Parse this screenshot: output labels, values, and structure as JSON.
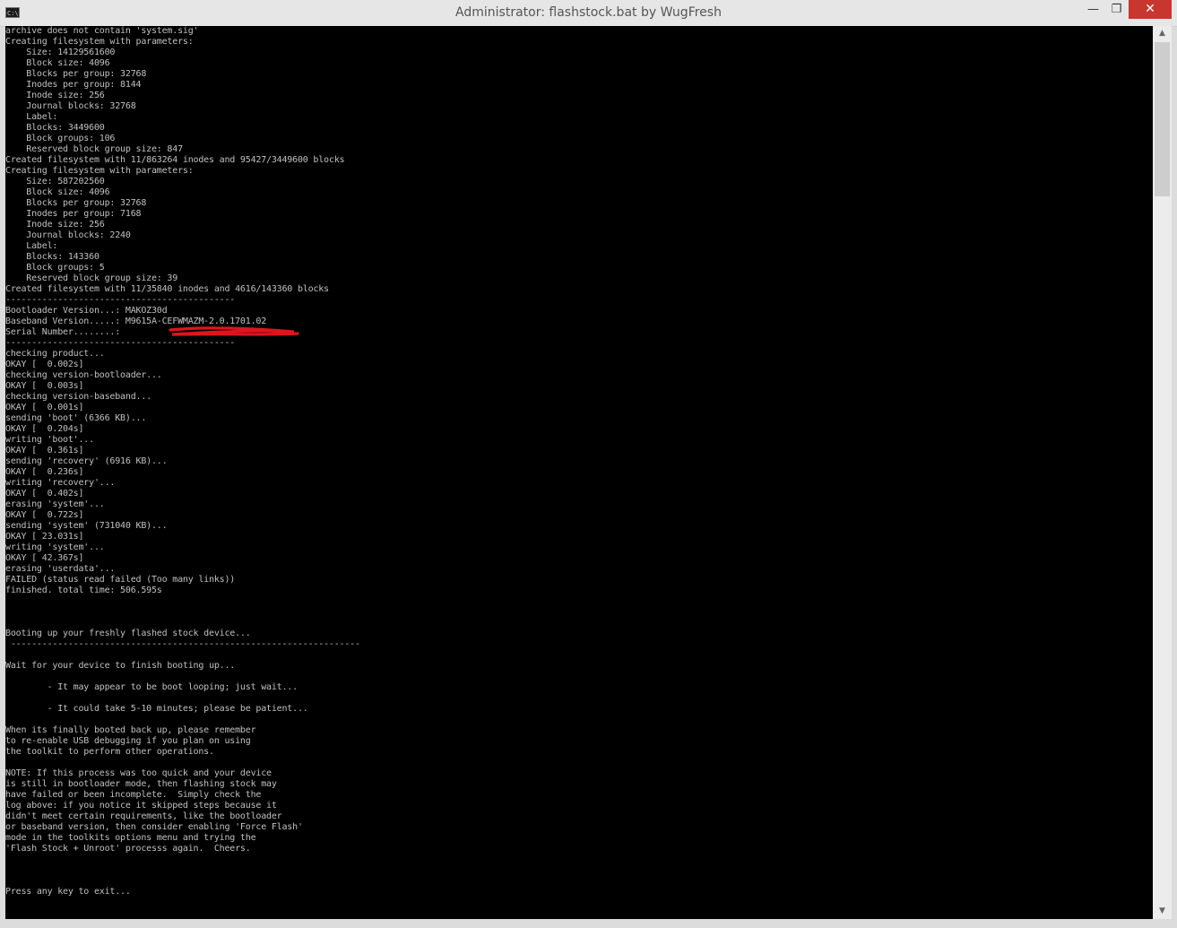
{
  "window": {
    "title": "Administrator:  flashstock.bat by WugFresh",
    "icon_text": "C:\\.",
    "min_glyph": "—",
    "max_glyph": "❐",
    "close_glyph": "✕"
  },
  "scrollbar": {
    "up_glyph": "▲",
    "down_glyph": "▼"
  },
  "colors": {
    "console_bg": "#000000",
    "console_text": "#c0c0c0",
    "close_button": "#c7372f",
    "redaction": "#e0141e"
  },
  "console": {
    "text": "archive does not contain 'system.sig'\nCreating filesystem with parameters:\n    Size: 14129561600\n    Block size: 4096\n    Blocks per group: 32768\n    Inodes per group: 8144\n    Inode size: 256\n    Journal blocks: 32768\n    Label:\n    Blocks: 3449600\n    Block groups: 106\n    Reserved block group size: 847\nCreated filesystem with 11/863264 inodes and 95427/3449600 blocks\nCreating filesystem with parameters:\n    Size: 587202560\n    Block size: 4096\n    Blocks per group: 32768\n    Inodes per group: 7168\n    Inode size: 256\n    Journal blocks: 2240\n    Label:\n    Blocks: 143360\n    Block groups: 5\n    Reserved block group size: 39\nCreated filesystem with 11/35840 inodes and 4616/143360 blocks\n--------------------------------------------\nBootloader Version...: MAKOZ30d\nBaseband Version.....: M9615A-CEFWMAZM-2.0.1701.02\nSerial Number........: \n--------------------------------------------\nchecking product...\nOKAY [  0.002s]\nchecking version-bootloader...\nOKAY [  0.003s]\nchecking version-baseband...\nOKAY [  0.001s]\nsending 'boot' (6366 KB)...\nOKAY [  0.204s]\nwriting 'boot'...\nOKAY [  0.361s]\nsending 'recovery' (6916 KB)...\nOKAY [  0.236s]\nwriting 'recovery'...\nOKAY [  0.402s]\nerasing 'system'...\nOKAY [  0.722s]\nsending 'system' (731040 KB)...\nOKAY [ 23.031s]\nwriting 'system'...\nOKAY [ 42.367s]\nerasing 'userdata'...\nFAILED (status read failed (Too many links))\nfinished. total time: 506.595s\n\n\n\nBooting up your freshly flashed stock device...\n -------------------------------------------------------------------\n\nWait for your device to finish booting up...\n\n        - It may appear to be boot looping; just wait...\n\n        - It could take 5-10 minutes; please be patient...\n\nWhen its finally booted back up, please remember\nto re-enable USB debugging if you plan on using\nthe toolkit to perform other operations.\n\nNOTE: If this process was too quick and your device\nis still in bootloader mode, then flashing stock may\nhave failed or been incomplete.  Simply check the\nlog above: if you notice it skipped steps because it\ndidn't meet certain requirements, like the bootloader\nor baseband version, then consider enabling 'Force Flash'\nmode in the toolkits options menu and trying the\n'Flash Stock + Unroot' processs again.  Cheers.\n\n\n\nPress any key to exit..."
  }
}
